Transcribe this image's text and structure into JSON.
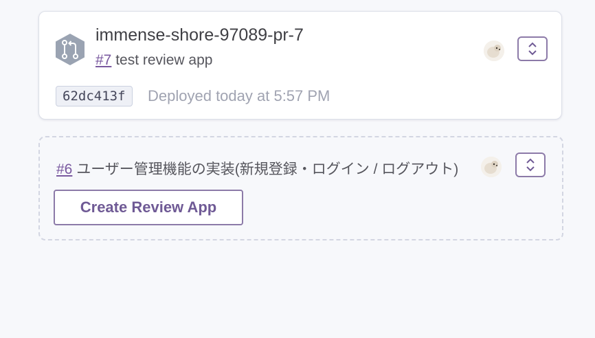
{
  "active_app": {
    "name": "immense-shore-97089-pr-7",
    "pr_number": "#7",
    "pr_title": "test review app",
    "commit_sha": "62dc413f",
    "deployed_text": "Deployed today at 5:57 PM",
    "icon": "pull-request-icon",
    "avatar": "user-avatar-dog"
  },
  "pending_app": {
    "pr_number": "#6",
    "pr_title": "ユーザー管理機能の実装(新規登録・ログイン / ログアウト)",
    "create_button_label": "Create Review App",
    "avatar": "user-avatar-dog"
  },
  "colors": {
    "accent": "#79589f",
    "border": "#8c7aa8",
    "muted_text": "#a0a3b1",
    "background": "#f7f8fb",
    "hex_icon": "#9aa3b2"
  }
}
